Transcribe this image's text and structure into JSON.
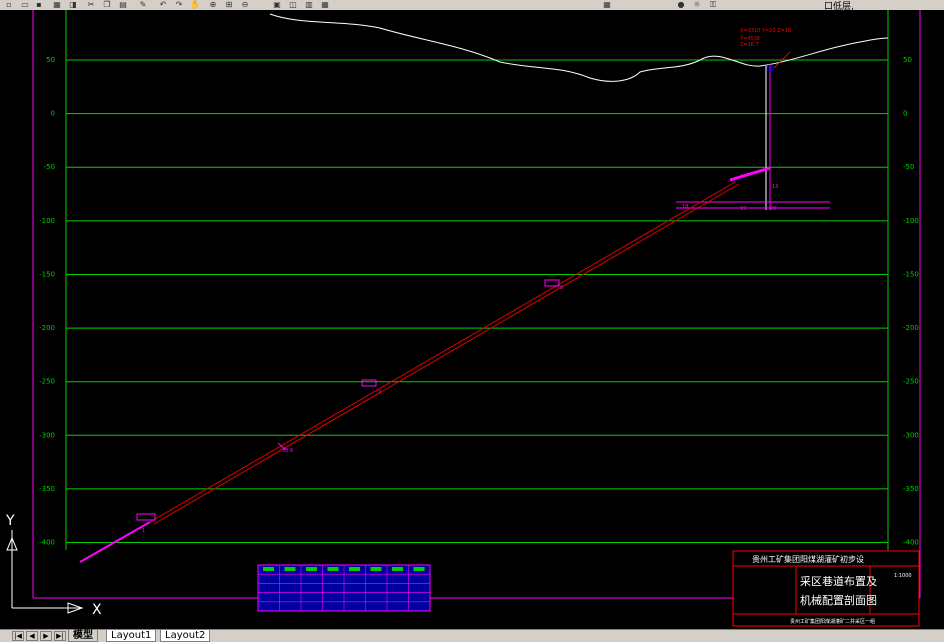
{
  "toolbar": {
    "icons": [
      "new-icon",
      "open-icon",
      "save-icon",
      "print-icon",
      "preview-icon",
      "cut-icon",
      "copy-icon",
      "paste-icon",
      "match-icon",
      "undo-icon",
      "redo-icon",
      "pan-icon",
      "zoom-realtime-icon",
      "zoom-window-icon",
      "zoom-previous-icon",
      "properties-icon",
      "design-center-icon",
      "tool-palette-icon",
      "calc-icon",
      "layer-icon",
      "lightbulb-icon",
      "sun-icon",
      "lock-icon"
    ],
    "tail_text": "口低层,"
  },
  "drawing": {
    "y_axis_left_labels": [
      "50",
      "0",
      "-50",
      "-100",
      "-150",
      "-200",
      "-250",
      "-300",
      "-350",
      "-400"
    ],
    "y_axis_right_labels": [
      "50",
      "0",
      "-50",
      "-100",
      "-150",
      "-200",
      "-250",
      "-300",
      "-350",
      "-400"
    ],
    "y_values": [
      50,
      0,
      -50,
      -100,
      -150,
      -200,
      -250,
      -300,
      -350,
      -400
    ],
    "annotation_labels": {
      "shaft_top": "4",
      "shaft_mid": "13",
      "mid1": "7",
      "mid2": "5",
      "mid3": "33.6",
      "bottom": "1"
    },
    "ucs": {
      "x": "X",
      "y": "Y"
    }
  },
  "title_block": {
    "header": "贵州工矿集团阳煤湖灌矿初步设",
    "title_line1": "采区巷道布置及",
    "title_line2": "机械配置剖面图",
    "scale": "1:1000",
    "footer": "贵州工矿集团阳煤湖灌矿二井采区一组"
  },
  "tabs": [
    {
      "label": "模型",
      "active": true
    },
    {
      "label": "Layout1",
      "active": false
    },
    {
      "label": "Layout2",
      "active": false
    }
  ],
  "colors": {
    "grid": "#00d000",
    "red_line": "#e00000",
    "magenta": "#ff00ff",
    "white": "#ffffff",
    "blue": "#0000c0"
  }
}
